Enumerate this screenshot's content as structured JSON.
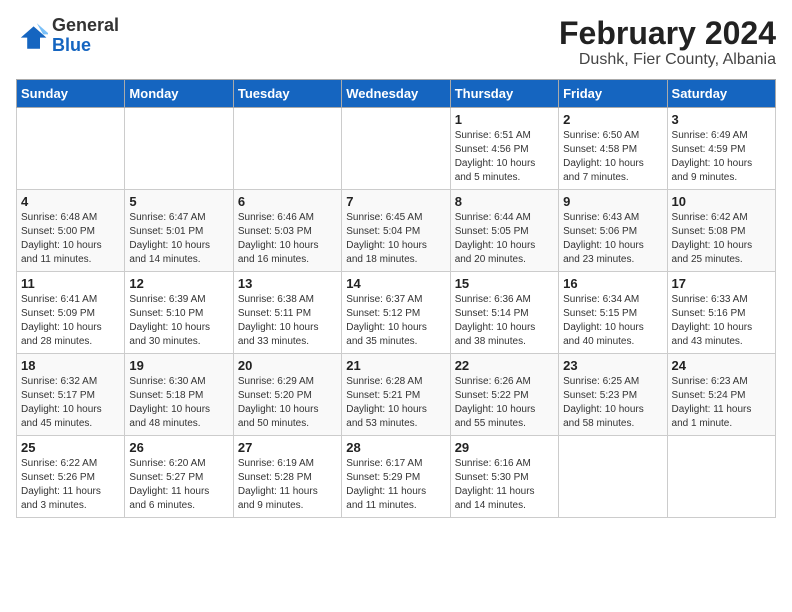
{
  "logo": {
    "general": "General",
    "blue": "Blue"
  },
  "title": "February 2024",
  "subtitle": "Dushk, Fier County, Albania",
  "days_of_week": [
    "Sunday",
    "Monday",
    "Tuesday",
    "Wednesday",
    "Thursday",
    "Friday",
    "Saturday"
  ],
  "weeks": [
    [
      {
        "day": "",
        "info": ""
      },
      {
        "day": "",
        "info": ""
      },
      {
        "day": "",
        "info": ""
      },
      {
        "day": "",
        "info": ""
      },
      {
        "day": "1",
        "info": "Sunrise: 6:51 AM\nSunset: 4:56 PM\nDaylight: 10 hours\nand 5 minutes."
      },
      {
        "day": "2",
        "info": "Sunrise: 6:50 AM\nSunset: 4:58 PM\nDaylight: 10 hours\nand 7 minutes."
      },
      {
        "day": "3",
        "info": "Sunrise: 6:49 AM\nSunset: 4:59 PM\nDaylight: 10 hours\nand 9 minutes."
      }
    ],
    [
      {
        "day": "4",
        "info": "Sunrise: 6:48 AM\nSunset: 5:00 PM\nDaylight: 10 hours\nand 11 minutes."
      },
      {
        "day": "5",
        "info": "Sunrise: 6:47 AM\nSunset: 5:01 PM\nDaylight: 10 hours\nand 14 minutes."
      },
      {
        "day": "6",
        "info": "Sunrise: 6:46 AM\nSunset: 5:03 PM\nDaylight: 10 hours\nand 16 minutes."
      },
      {
        "day": "7",
        "info": "Sunrise: 6:45 AM\nSunset: 5:04 PM\nDaylight: 10 hours\nand 18 minutes."
      },
      {
        "day": "8",
        "info": "Sunrise: 6:44 AM\nSunset: 5:05 PM\nDaylight: 10 hours\nand 20 minutes."
      },
      {
        "day": "9",
        "info": "Sunrise: 6:43 AM\nSunset: 5:06 PM\nDaylight: 10 hours\nand 23 minutes."
      },
      {
        "day": "10",
        "info": "Sunrise: 6:42 AM\nSunset: 5:08 PM\nDaylight: 10 hours\nand 25 minutes."
      }
    ],
    [
      {
        "day": "11",
        "info": "Sunrise: 6:41 AM\nSunset: 5:09 PM\nDaylight: 10 hours\nand 28 minutes."
      },
      {
        "day": "12",
        "info": "Sunrise: 6:39 AM\nSunset: 5:10 PM\nDaylight: 10 hours\nand 30 minutes."
      },
      {
        "day": "13",
        "info": "Sunrise: 6:38 AM\nSunset: 5:11 PM\nDaylight: 10 hours\nand 33 minutes."
      },
      {
        "day": "14",
        "info": "Sunrise: 6:37 AM\nSunset: 5:12 PM\nDaylight: 10 hours\nand 35 minutes."
      },
      {
        "day": "15",
        "info": "Sunrise: 6:36 AM\nSunset: 5:14 PM\nDaylight: 10 hours\nand 38 minutes."
      },
      {
        "day": "16",
        "info": "Sunrise: 6:34 AM\nSunset: 5:15 PM\nDaylight: 10 hours\nand 40 minutes."
      },
      {
        "day": "17",
        "info": "Sunrise: 6:33 AM\nSunset: 5:16 PM\nDaylight: 10 hours\nand 43 minutes."
      }
    ],
    [
      {
        "day": "18",
        "info": "Sunrise: 6:32 AM\nSunset: 5:17 PM\nDaylight: 10 hours\nand 45 minutes."
      },
      {
        "day": "19",
        "info": "Sunrise: 6:30 AM\nSunset: 5:18 PM\nDaylight: 10 hours\nand 48 minutes."
      },
      {
        "day": "20",
        "info": "Sunrise: 6:29 AM\nSunset: 5:20 PM\nDaylight: 10 hours\nand 50 minutes."
      },
      {
        "day": "21",
        "info": "Sunrise: 6:28 AM\nSunset: 5:21 PM\nDaylight: 10 hours\nand 53 minutes."
      },
      {
        "day": "22",
        "info": "Sunrise: 6:26 AM\nSunset: 5:22 PM\nDaylight: 10 hours\nand 55 minutes."
      },
      {
        "day": "23",
        "info": "Sunrise: 6:25 AM\nSunset: 5:23 PM\nDaylight: 10 hours\nand 58 minutes."
      },
      {
        "day": "24",
        "info": "Sunrise: 6:23 AM\nSunset: 5:24 PM\nDaylight: 11 hours\nand 1 minute."
      }
    ],
    [
      {
        "day": "25",
        "info": "Sunrise: 6:22 AM\nSunset: 5:26 PM\nDaylight: 11 hours\nand 3 minutes."
      },
      {
        "day": "26",
        "info": "Sunrise: 6:20 AM\nSunset: 5:27 PM\nDaylight: 11 hours\nand 6 minutes."
      },
      {
        "day": "27",
        "info": "Sunrise: 6:19 AM\nSunset: 5:28 PM\nDaylight: 11 hours\nand 9 minutes."
      },
      {
        "day": "28",
        "info": "Sunrise: 6:17 AM\nSunset: 5:29 PM\nDaylight: 11 hours\nand 11 minutes."
      },
      {
        "day": "29",
        "info": "Sunrise: 6:16 AM\nSunset: 5:30 PM\nDaylight: 11 hours\nand 14 minutes."
      },
      {
        "day": "",
        "info": ""
      },
      {
        "day": "",
        "info": ""
      }
    ]
  ]
}
